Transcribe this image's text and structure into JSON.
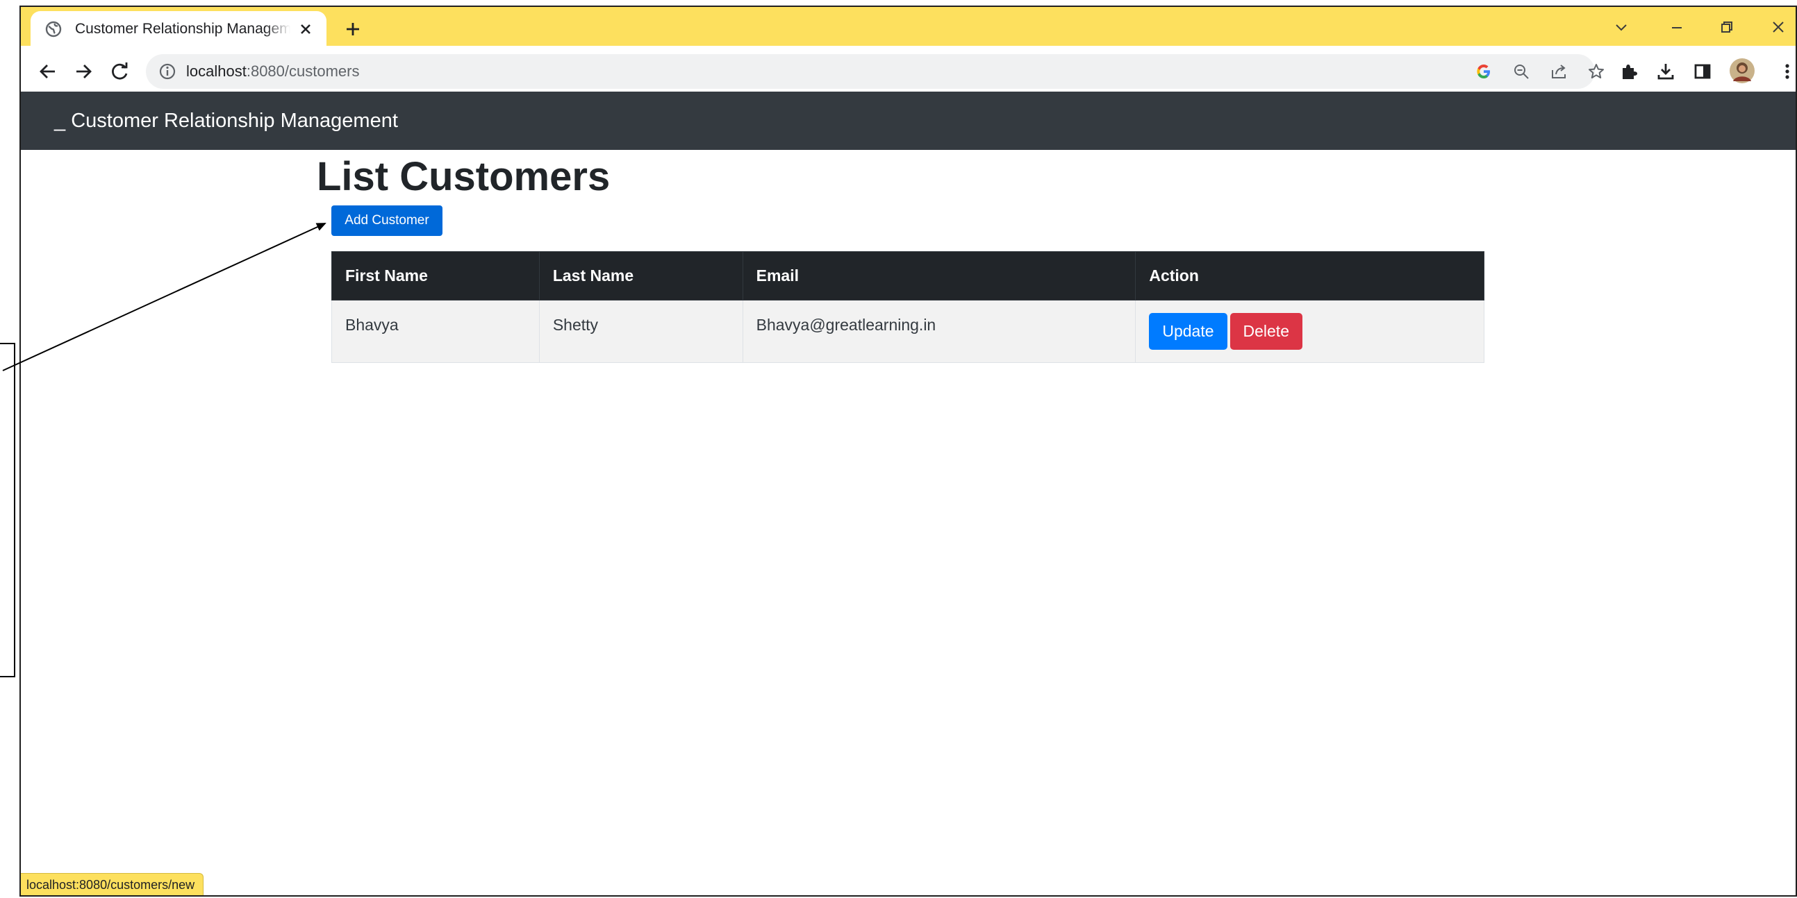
{
  "browser": {
    "tab_title": "Customer Relationship Management",
    "url_host": "localhost",
    "url_path": ":8080/customers",
    "status_url": "localhost:8080/customers/new"
  },
  "navbar": {
    "brand_prefix": "_",
    "brand": "Customer Relationship Management"
  },
  "page": {
    "title": "List Customers",
    "add_button": "Add Customer"
  },
  "table": {
    "headers": [
      "First Name",
      "Last Name",
      "Email",
      "Action"
    ],
    "rows": [
      {
        "first_name": "Bhavya",
        "last_name": "Shetty",
        "email": "Bhavya@greatlearning.in",
        "update_label": "Update",
        "delete_label": "Delete"
      }
    ]
  },
  "colors": {
    "tab_strip": "#fde05e",
    "navbar": "#343a40",
    "table_header": "#212529",
    "update": "#007bff",
    "delete": "#dc3545",
    "add": "#0069d9"
  },
  "icons": {
    "favicon": "globe-icon",
    "back": "arrow-left-icon",
    "forward": "arrow-right-icon",
    "reload": "reload-icon",
    "site_info": "info-icon",
    "google": "google-icon",
    "zoom": "zoom-out-icon",
    "share": "share-icon",
    "bookmark": "star-icon",
    "extensions": "puzzle-icon",
    "downloads": "download-icon",
    "side_panel": "side-panel-icon",
    "profile": "avatar",
    "menu": "kebab-menu-icon"
  }
}
